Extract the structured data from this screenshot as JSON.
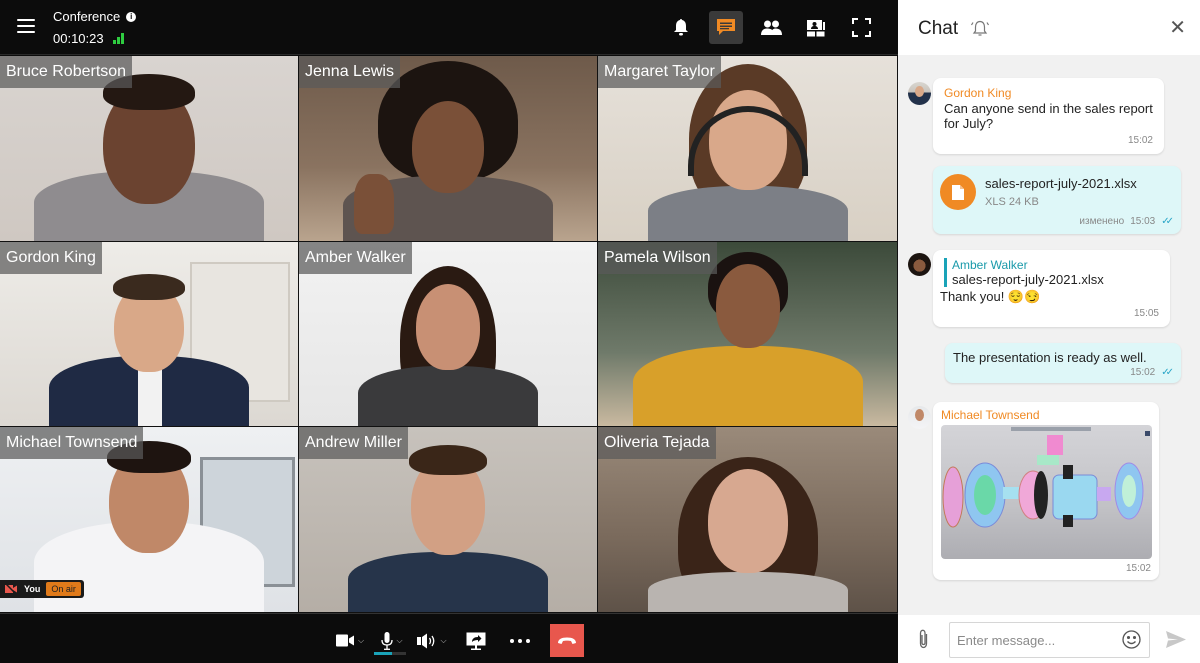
{
  "topbar": {
    "title": "Conference",
    "timer": "00:10:23",
    "buttons": [
      {
        "name": "notifications-button",
        "icon": "bell-icon",
        "active": false
      },
      {
        "name": "chat-button",
        "icon": "chat-icon",
        "active": true
      },
      {
        "name": "participants-button",
        "icon": "people-icon",
        "active": false
      },
      {
        "name": "layout-button",
        "icon": "layout-icon",
        "active": false
      },
      {
        "name": "fullscreen-button",
        "icon": "fullscreen-icon",
        "active": false
      }
    ]
  },
  "participants": [
    {
      "name": "Bruce Robertson"
    },
    {
      "name": "Jenna Lewis"
    },
    {
      "name": "Margaret Taylor"
    },
    {
      "name": "Gordon King"
    },
    {
      "name": "Amber Walker"
    },
    {
      "name": "Pamela Wilson"
    },
    {
      "name": "Michael Townsend"
    },
    {
      "name": "Andrew Miller"
    },
    {
      "name": "Oliveria Tejada"
    }
  ],
  "self_badge": {
    "label": "You",
    "status": "On air"
  },
  "controls": {
    "mic_level_percent": 55,
    "colors": {
      "accent": "#f08a24",
      "hangup": "#e8574d",
      "mic_level": "#1aa3b8"
    }
  },
  "chat": {
    "title": "Chat",
    "messages": [
      {
        "sender": "Gordon King",
        "text": "Can anyone send in the sales report for July?",
        "time": "15:02"
      },
      {
        "type": "file",
        "file_name": "sales-report-july-2021.xlsx",
        "file_meta": "XLS 24 KB",
        "edited_label": "изменено",
        "time": "15:03"
      },
      {
        "quote_name": "Amber Walker",
        "quote_text": "sales-report-july-2021.xlsx",
        "text": "Thank you!  😌😏",
        "time": "15:05"
      },
      {
        "text": "The presentation is ready as well.",
        "time": "15:02"
      },
      {
        "sender": "Michael Townsend",
        "type": "image",
        "time": "15:02"
      }
    ],
    "composer": {
      "placeholder": "Enter message..."
    }
  }
}
